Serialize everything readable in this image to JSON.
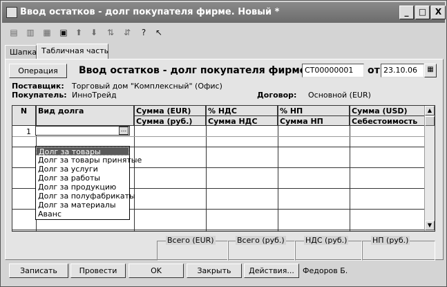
{
  "window": {
    "title": "Ввод остатков - долг покупателя фирме. Новый *",
    "minimize": "_",
    "maximize": "□",
    "close": "X"
  },
  "toolbar": {
    "icons": [
      "new-row-icon",
      "copy-row-icon",
      "edit-row-icon",
      "delete-row-icon",
      "move-up-icon",
      "move-down-icon",
      "sort-asc-icon",
      "sort-desc-icon",
      "help-icon",
      "context-help-icon"
    ]
  },
  "tabs": [
    "Шапка",
    "Табличная часть"
  ],
  "header": {
    "operation_button": "Операция",
    "doc_title": "Ввод остатков - долг покупателя фирме №",
    "number": "СТ00000001",
    "date_label": "от",
    "date": "23.10.06",
    "supplier_label": "Поставщик:",
    "supplier": "Торговый дом \"Комплексный\" (Офис)",
    "buyer_label": "Покупатель:",
    "buyer": "ИнноТрейд",
    "contract_label": "Договор:",
    "contract": "Основной (EUR)"
  },
  "table": {
    "columns": {
      "n": "N",
      "kind": "Вид долга",
      "sum_eur": "Сумма (EUR)",
      "sum_rub": "Сумма (руб.)",
      "vat_pct": "% НДС",
      "vat_sum": "Сумма НДС",
      "np_pct": "% НП",
      "np_sum": "Сумма НП",
      "sum_usd": "Сумма (USD)",
      "cost": "Себестоимость"
    },
    "row_number": "1",
    "ellipsis": "..."
  },
  "dropdown": {
    "items": [
      "Долг за товары",
      "Долг за товары принятые",
      "Долг за услуги",
      "Долг за работы",
      "Долг за продукцию",
      "Долг за полуфабрикаты",
      "Долг за материалы",
      "Аванс"
    ],
    "selected_index": 0
  },
  "totals": {
    "total_eur": "Всего (EUR)",
    "total_rub": "Всего (руб.)",
    "vat_rub": "НДС (руб.)",
    "np_rub": "НП (руб.)"
  },
  "footer": {
    "save": "Записать",
    "post": "Провести",
    "ok": "OK",
    "close": "Закрыть",
    "actions": "Действия...",
    "author": "Федоров Б."
  }
}
